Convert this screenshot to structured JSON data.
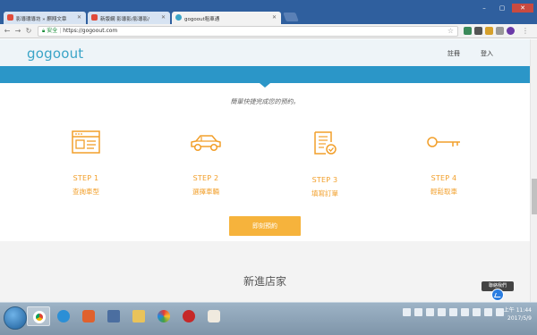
{
  "browser": {
    "tabs": [
      {
        "label": "影導環導坊 » 麒翔文章"
      },
      {
        "label": "新版網 影導影/影導影/"
      },
      {
        "label": "gogoout租車通"
      }
    ],
    "address": {
      "secure_label": "安全",
      "url": "https://gogoout.com"
    }
  },
  "header": {
    "logo": "gogoout",
    "nav": {
      "register": "註冊",
      "login": "登入"
    }
  },
  "hero": {
    "subtitle": "簡單快捷完成您的預約。"
  },
  "steps": [
    {
      "label": "STEP 1",
      "desc": "查詢車型",
      "icon": "browser-window-icon"
    },
    {
      "label": "STEP 2",
      "desc": "選擇車輛",
      "icon": "car-icon"
    },
    {
      "label": "STEP 3",
      "desc": "填寫訂單",
      "icon": "form-checklist-icon"
    },
    {
      "label": "STEP 4",
      "desc": "輕鬆取車",
      "icon": "key-icon"
    }
  ],
  "cta": {
    "label": "即刻預約"
  },
  "section": {
    "title": "新進店家"
  },
  "chat": {
    "tooltip": "聯絡我們"
  },
  "taskbar": {
    "clock_time": "上午 11:44",
    "clock_date": "2017/5/9",
    "tray_lang": "CH"
  },
  "colors": {
    "accent": "#f29f2a",
    "band": "#2b96c8",
    "logo": "#3aa4c7"
  }
}
